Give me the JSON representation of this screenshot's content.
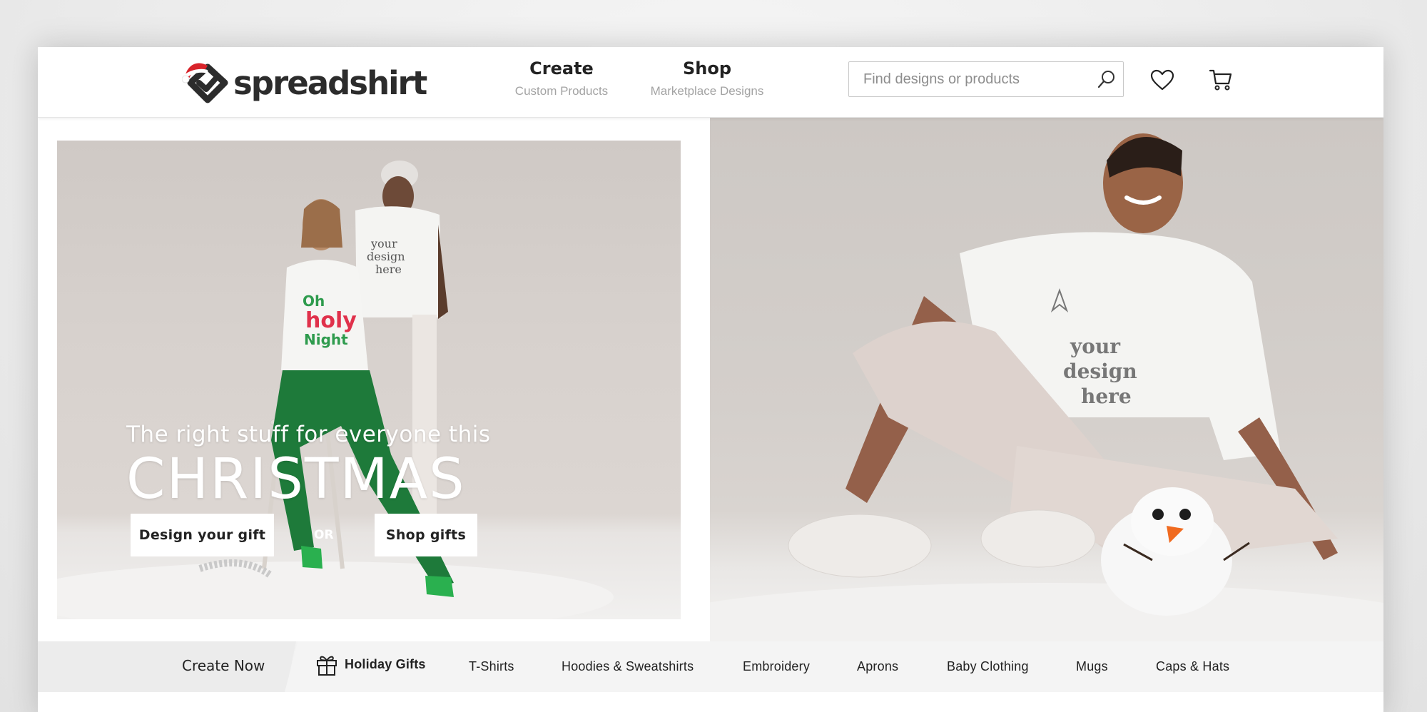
{
  "header": {
    "logo_text": "spreadshirt",
    "nav": [
      {
        "title": "Create",
        "subtitle": "Custom Products"
      },
      {
        "title": "Shop",
        "subtitle": "Marketplace Designs"
      }
    ],
    "search": {
      "placeholder": "Find designs or products"
    },
    "icons": [
      "search-icon",
      "heart-icon",
      "cart-icon"
    ]
  },
  "hero": {
    "headline_sub": "The right stuff for everyone this",
    "headline_main": "CHRISTMAS",
    "cta_design": "Design your gift",
    "cta_or": "OR",
    "cta_shop": "Shop gifts"
  },
  "categories": {
    "create_now": "Create Now",
    "items": [
      "Holiday Gifts",
      "T-Shirts",
      "Hoodies & Sweatshirts",
      "Embroidery",
      "Aprons",
      "Baby Clothing",
      "Mugs",
      "Caps & Hats"
    ]
  },
  "colors": {
    "text_dark": "#222222",
    "text_muted": "#a3a3a3",
    "brand_logo": "#2c2c2c",
    "santa_hat": "#d8232a",
    "category_bar": "#f2f2f2"
  }
}
